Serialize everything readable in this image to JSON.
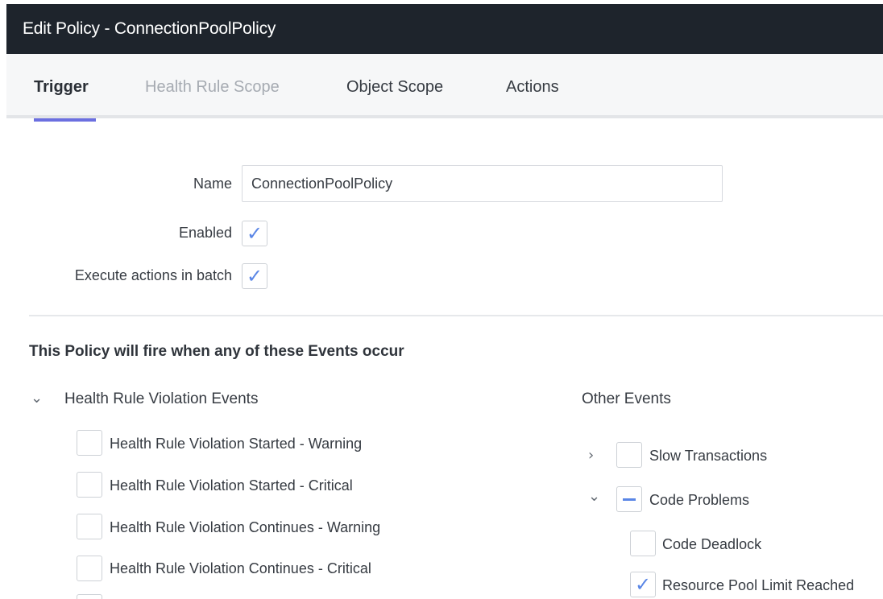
{
  "window": {
    "title": "Edit Policy - ConnectionPoolPolicy"
  },
  "tabs": {
    "trigger": "Trigger",
    "health_rule_scope": "Health Rule Scope",
    "object_scope": "Object Scope",
    "actions": "Actions"
  },
  "form": {
    "name_label": "Name",
    "name_value": "ConnectionPoolPolicy",
    "enabled_label": "Enabled",
    "enabled_checked": true,
    "batch_label": "Execute actions in batch",
    "batch_checked": true
  },
  "events": {
    "section_title": "This Policy will fire when any of these Events occur",
    "health_rule_group": {
      "label": "Health Rule Violation Events",
      "items": [
        {
          "label": "Health Rule Violation Started - Warning",
          "checked": false
        },
        {
          "label": "Health Rule Violation Started - Critical",
          "checked": false
        },
        {
          "label": "Health Rule Violation Continues - Warning",
          "checked": false
        },
        {
          "label": "Health Rule Violation Continues - Critical",
          "checked": false
        }
      ]
    },
    "other_group": {
      "label": "Other Events",
      "slow_transactions": "Slow Transactions",
      "code_problems": "Code Problems",
      "code_deadlock": "Code Deadlock",
      "resource_pool": "Resource Pool Limit Reached"
    }
  },
  "icons": {
    "check": "check-icon",
    "chevron_down": "chevron-down-icon",
    "chevron_right": "chevron-right-icon"
  },
  "colors": {
    "titlebar_bg": "#1e242c",
    "tab_active_indicator": "#6b6fe0",
    "check_accent": "#5a86e6"
  }
}
